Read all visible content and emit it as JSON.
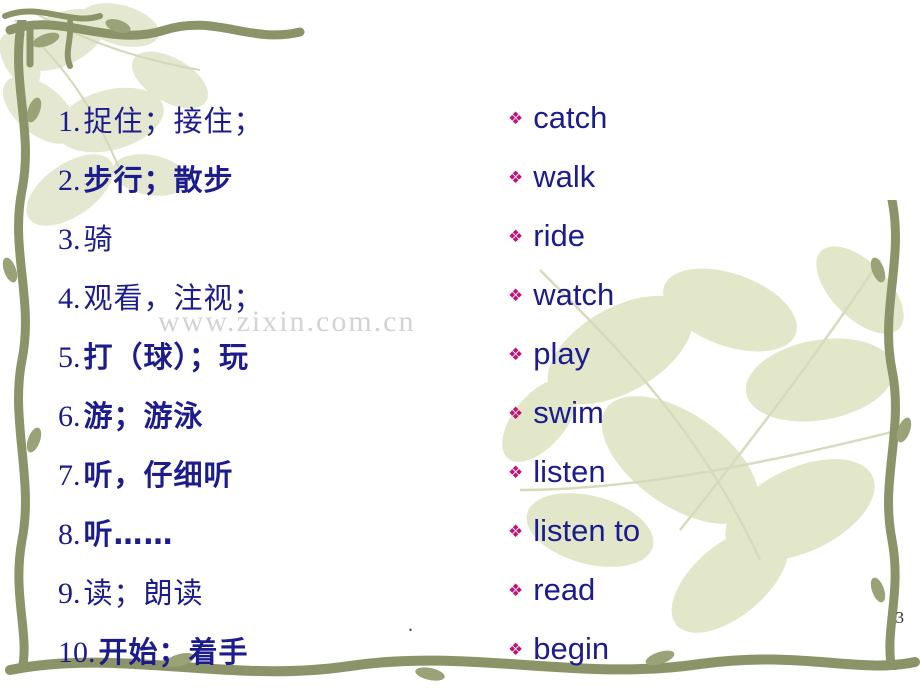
{
  "slide": {
    "page_number": "3",
    "watermark": "www.zixin.com.cn",
    "center_mark": ".",
    "colors": {
      "text": "#1c1c8c",
      "bullet": "#c0127a",
      "vine": "#8a9468",
      "leaf": "#dfe3c8"
    },
    "items": [
      {
        "num": "1.",
        "chinese": "捉住；接住；",
        "bullet": "❖",
        "english": "catch"
      },
      {
        "num": "2.",
        "chinese": "步行；散步",
        "bullet": "❖",
        "english": "walk"
      },
      {
        "num": "3.",
        "chinese": "骑",
        "bullet": "❖",
        "english": "ride"
      },
      {
        "num": "4.",
        "chinese": "观看，注视；",
        "bullet": "❖",
        "english": "watch"
      },
      {
        "num": "5.",
        "chinese": "打（球）；玩",
        "bullet": "❖",
        "english": "play"
      },
      {
        "num": "6.",
        "chinese": "游；游泳",
        "bullet": "❖",
        "english": "swim"
      },
      {
        "num": "7.",
        "chinese": "听，仔细听",
        "bullet": "❖",
        "english": "listen"
      },
      {
        "num": "8.",
        "chinese": "听……",
        "bullet": "❖",
        "english": "listen to"
      },
      {
        "num": "9.",
        "chinese": "读；朗读",
        "bullet": "❖",
        "english": "read"
      },
      {
        "num": "10.",
        "chinese": "开始；着手",
        "bullet": "❖",
        "english": "begin"
      }
    ]
  }
}
